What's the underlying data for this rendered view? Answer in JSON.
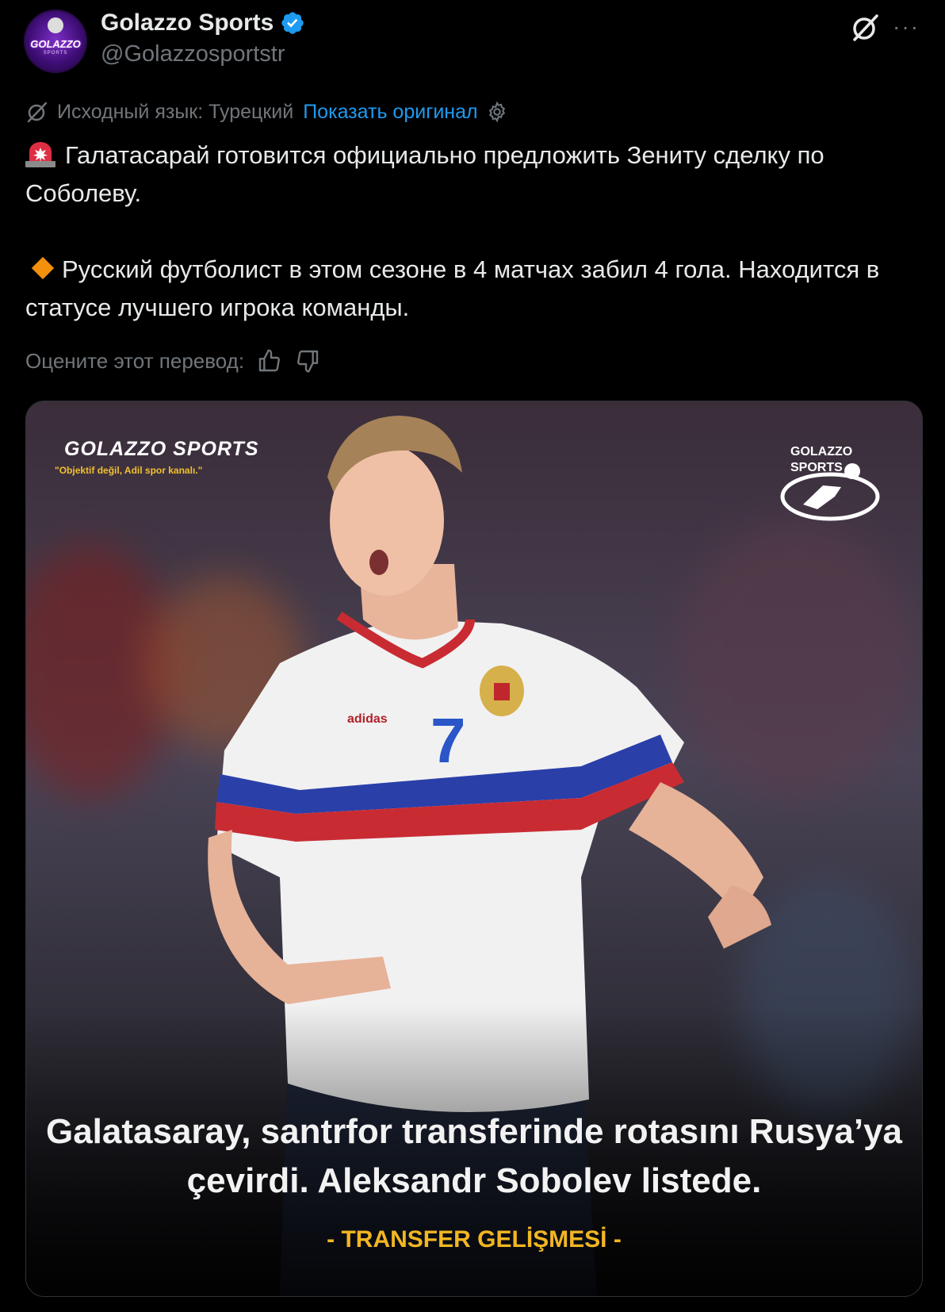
{
  "author": {
    "display_name": "Golazzo Sports",
    "handle": "@Golazzosportstr",
    "avatar_text": "GOLAZZO",
    "avatar_subtext": "SPORTS"
  },
  "translation": {
    "source_label": "Исходный язык: Турецкий",
    "show_original_label": "Показать оригинал"
  },
  "tweet": {
    "paragraph_1": "Галатасарай готовится официально предложить Зениту сделку по Соболеву.",
    "paragraph_2": "Русский футболист в этом сезоне в 4 матчах забил 4 гола. Находится в статусе лучшего игрока команды."
  },
  "rating": {
    "label": "Оцените этот перевод:"
  },
  "media": {
    "brand": "GOLAZZO SPORTS",
    "slogan": "\"Objektif değil, Adil spor kanalı.\"",
    "logo_line_1": "GOLAZZO",
    "logo_line_2": "SPORTS",
    "jersey_number": "7",
    "jersey_brand": "adidas",
    "headline": "Galatasaray, santrfor transferinde rotasını Rusya’ya çevirdi. Aleksandr Sobolev listede.",
    "tag": "- TRANSFER GELİŞMESİ -"
  },
  "colors": {
    "background": "#000000",
    "text_primary": "#e7e9ea",
    "text_secondary": "#71767b",
    "link": "#1d9bf0",
    "verified": "#1d9bf0",
    "tag_yellow": "#f2b622"
  },
  "icons": [
    "verified-badge-icon",
    "grok-icon",
    "more-icon",
    "translate-icon",
    "gear-icon",
    "siren-emoji-icon",
    "orange-diamond-icon",
    "thumbs-up-icon",
    "thumbs-down-icon"
  ]
}
